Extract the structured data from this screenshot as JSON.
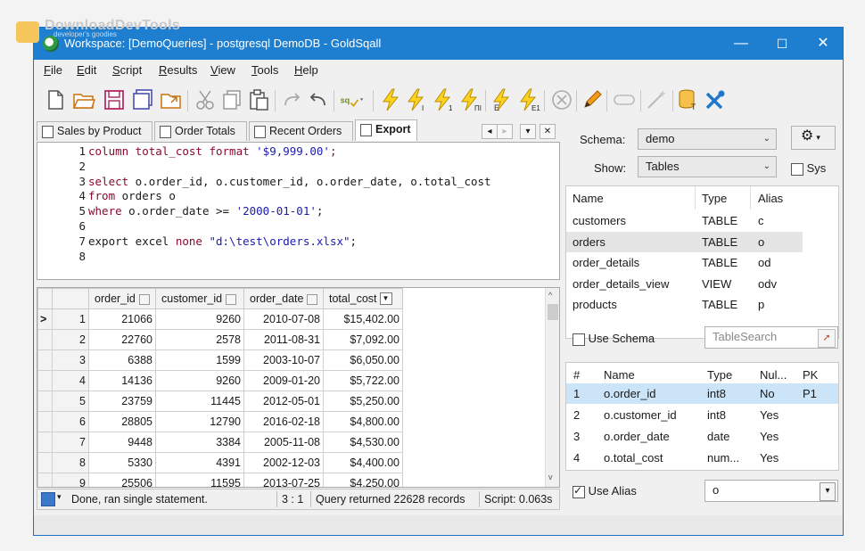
{
  "watermark": {
    "text": "DownloadDevTools",
    "sub": "developer's goodies"
  },
  "window": {
    "title": "Workspace: [DemoQueries] - postgresql DemoDB - GoldSqall",
    "controls": {
      "minimize": "—",
      "maximize": "☐",
      "close": "✕"
    }
  },
  "menu": [
    {
      "u": "F",
      "rest": "ile"
    },
    {
      "u": "E",
      "rest": "dit"
    },
    {
      "u": "S",
      "rest": "cript"
    },
    {
      "u": "R",
      "rest": "esults"
    },
    {
      "u": "V",
      "rest": "iew"
    },
    {
      "u": "T",
      "rest": "ools"
    },
    {
      "u": "H",
      "rest": "elp"
    }
  ],
  "tabs": [
    "Sales by Product",
    "Order Totals",
    "Recent Orders",
    "Export"
  ],
  "tab_controls": {
    "prev": "◂",
    "next": "▸",
    "menu": "▾",
    "close": "✕"
  },
  "editor": {
    "line_numbers": [
      "1",
      "2",
      "3",
      "4",
      "5",
      "6",
      "7",
      "8"
    ],
    "lines": [
      [
        {
          "t": "column total_cost format ",
          "c": "kw"
        },
        {
          "t": "'$9,999.00'",
          "c": "str"
        },
        {
          "t": ";",
          "c": "kw"
        }
      ],
      [],
      [
        {
          "t": "select",
          "c": "kw"
        },
        {
          "t": " o.order_id, o.customer_id, o.order_date, o.total_cost",
          "c": ""
        }
      ],
      [
        {
          "t": "from",
          "c": "kw"
        },
        {
          "t": " orders o",
          "c": ""
        }
      ],
      [
        {
          "t": "where",
          "c": "kw"
        },
        {
          "t": " o.order_date >= ",
          "c": ""
        },
        {
          "t": "'2000-01-01'",
          "c": "str"
        },
        {
          "t": ";",
          "c": ""
        }
      ],
      [],
      [
        {
          "t": "export excel ",
          "c": ""
        },
        {
          "t": "none",
          "c": "kw"
        },
        {
          "t": " ",
          "c": ""
        },
        {
          "t": "\"d:\\test\\orders.xlsx\"",
          "c": "str"
        },
        {
          "t": ";",
          "c": ""
        }
      ],
      []
    ]
  },
  "grid": {
    "columns": [
      "order_id",
      "customer_id",
      "order_date",
      "total_cost"
    ],
    "rows": [
      [
        "1",
        "21066",
        "9260",
        "2010-07-08",
        "$15,402.00"
      ],
      [
        "2",
        "22760",
        "2578",
        "2011-08-31",
        "$7,092.00"
      ],
      [
        "3",
        "6388",
        "1599",
        "2003-10-07",
        "$6,050.00"
      ],
      [
        "4",
        "14136",
        "9260",
        "2009-01-20",
        "$5,722.00"
      ],
      [
        "5",
        "23759",
        "11445",
        "2012-05-01",
        "$5,250.00"
      ],
      [
        "6",
        "28805",
        "12790",
        "2016-02-18",
        "$4,800.00"
      ],
      [
        "7",
        "9448",
        "3384",
        "2005-11-08",
        "$4,530.00"
      ],
      [
        "8",
        "5330",
        "4391",
        "2002-12-03",
        "$4,400.00"
      ],
      [
        "9",
        "25506",
        "11595",
        "2013-07-25",
        "$4,250.00"
      ]
    ],
    "current_row_marker": ">"
  },
  "status": {
    "message": "Done, ran single statement.",
    "position": "3 : 1",
    "records": "Query returned 22628 records",
    "script_time": "Script: 0.063s"
  },
  "right_panel": {
    "schema_label": "Schema:",
    "schema_value": "demo",
    "show_label": "Show:",
    "show_value": "Tables",
    "sys_label": "Sys",
    "objects_headers": [
      "Name",
      "Type",
      "Alias"
    ],
    "objects": [
      [
        "customers",
        "TABLE",
        "c"
      ],
      [
        "orders",
        "TABLE",
        "o"
      ],
      [
        "order_details",
        "TABLE",
        "od"
      ],
      [
        "order_details_view",
        "VIEW",
        "odv"
      ],
      [
        "products",
        "TABLE",
        "p"
      ]
    ],
    "use_schema_label": "Use Schema",
    "table_search_placeholder": "TableSearch",
    "columns_headers": [
      "#",
      "Name",
      "Type",
      "Nul...",
      "PK"
    ],
    "columns": [
      [
        "1",
        "o.order_id",
        "int8",
        "No",
        "P1"
      ],
      [
        "2",
        "o.customer_id",
        "int8",
        "Yes",
        ""
      ],
      [
        "3",
        "o.order_date",
        "date",
        "Yes",
        ""
      ],
      [
        "4",
        "o.total_cost",
        "num...",
        "Yes",
        ""
      ]
    ],
    "use_alias_label": "Use Alias",
    "alias_value": "o"
  }
}
